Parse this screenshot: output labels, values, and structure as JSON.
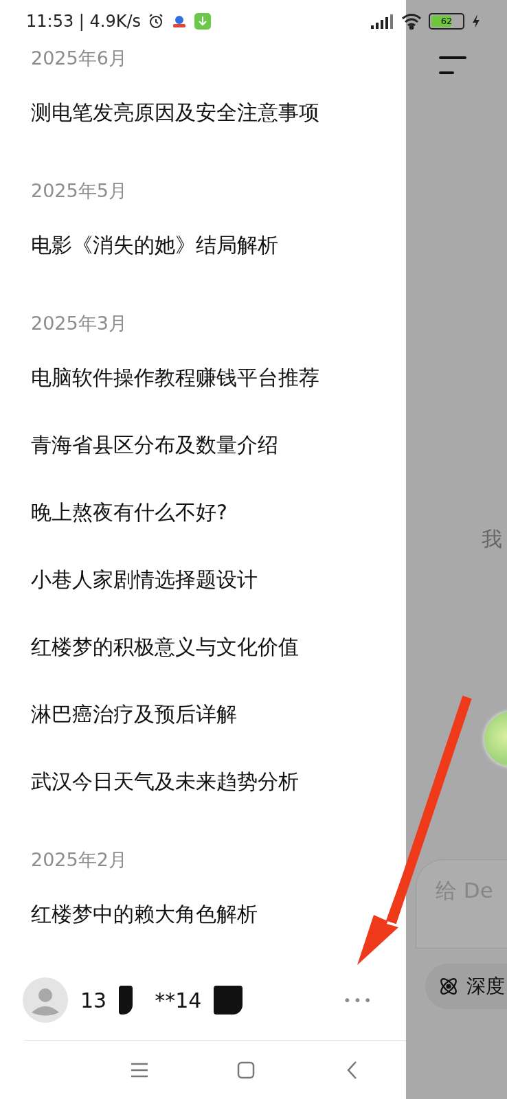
{
  "status_bar": {
    "time": "11:53 | 4.9K/s",
    "battery": "62"
  },
  "history": [
    {
      "month": "2025年6月",
      "items": [
        "测电笔发亮原因及安全注意事项"
      ]
    },
    {
      "month": "2025年5月",
      "items": [
        "电影《消失的她》结局解析"
      ]
    },
    {
      "month": "2025年3月",
      "items": [
        "电脑软件操作教程赚钱平台推荐",
        "青海省县区分布及数量介绍",
        "晚上熬夜有什么不好?",
        "小巷人家剧情选择题设计",
        "红楼梦的积极意义与文化价值",
        "淋巴癌治疗及预后详解",
        "武汉今日天气及未来趋势分析"
      ]
    },
    {
      "month": "2025年2月",
      "items": [
        "红楼梦中的赖大角色解析"
      ]
    }
  ],
  "user": {
    "name_parts": [
      "13",
      "**14"
    ],
    "more": "•••"
  },
  "chat": {
    "greeting": "我",
    "input": {
      "placeholder": "给 De"
    },
    "chip": "深度"
  }
}
